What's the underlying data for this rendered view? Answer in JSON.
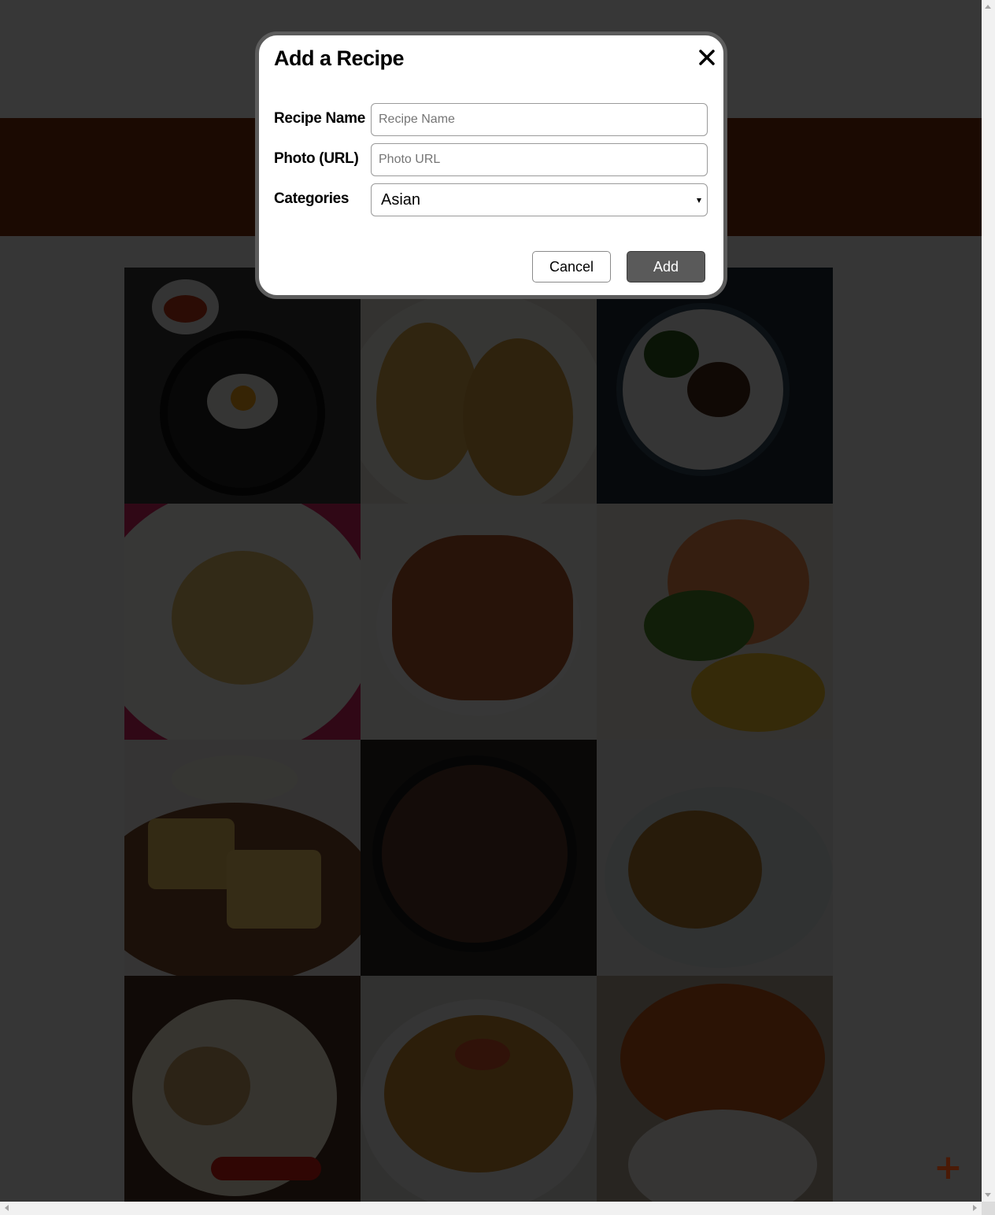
{
  "modal": {
    "title": "Add a Recipe",
    "close_icon": "close-icon",
    "fields": {
      "recipe_name": {
        "label": "Recipe Name",
        "placeholder": "Recipe Name",
        "value": ""
      },
      "photo_url": {
        "label": "Photo (URL)",
        "placeholder": "Photo URL",
        "value": ""
      },
      "categories": {
        "label": "Categories",
        "selected": "Asian"
      }
    },
    "buttons": {
      "cancel": "Cancel",
      "add": "Add"
    }
  },
  "fab": {
    "icon": "plus-icon",
    "glyph": "+"
  },
  "colors": {
    "hero_band": "#7a2d0a",
    "fab": "#4a1a06",
    "add_button": "#5a5a5a",
    "overlay": "rgba(0,0,0,0.78)"
  },
  "recipe_grid": {
    "tiles": [
      {
        "icon": "bibimbap-photo"
      },
      {
        "icon": "tacos-photo"
      },
      {
        "icon": "steak-plate-photo"
      },
      {
        "icon": "shrimp-pasta-photo"
      },
      {
        "icon": "salmon-fillet-photo"
      },
      {
        "icon": "grilled-shrimp-photo"
      },
      {
        "icon": "cornbread-photo"
      },
      {
        "icon": "ground-beef-bowl-photo"
      },
      {
        "icon": "mushroom-chicken-photo"
      },
      {
        "icon": "burrito-photo"
      },
      {
        "icon": "enchiladas-photo"
      },
      {
        "icon": "orange-chicken-photo"
      }
    ]
  }
}
